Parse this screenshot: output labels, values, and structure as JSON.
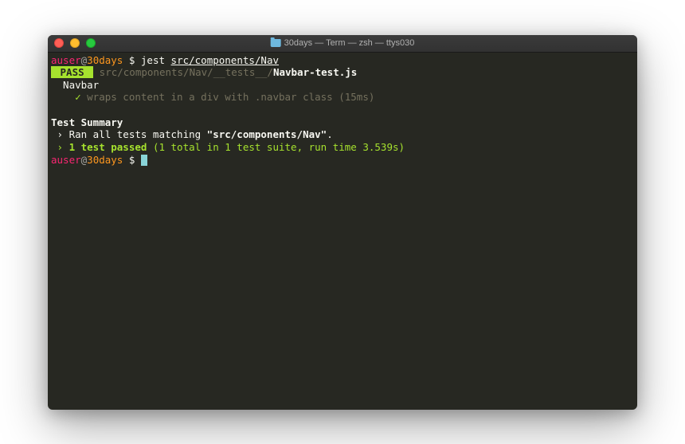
{
  "window": {
    "title": "30days — Term — zsh — ttys030"
  },
  "prompt": {
    "user": "auser",
    "at": "@",
    "host": "30days",
    "symbol": " $ ",
    "command": "jest ",
    "arg": "src/components/Nav"
  },
  "output": {
    "pass_label": " PASS ",
    "pass_path_dim": " src/components/Nav/__tests__/",
    "pass_file": "Navbar-test.js",
    "suite_name": "  Navbar",
    "check_mark": "    ✓ ",
    "test_desc": "wraps content in a div with .navbar class (15ms)",
    "summary_header": "Test Summary",
    "ran_prefix": " › Ran all tests matching ",
    "ran_match": "\"src/components/Nav\"",
    "ran_suffix": ".",
    "passed_prefix": " › ",
    "passed_bold": "1 test passed",
    "passed_rest": " (1 total in 1 test suite, run time 3.539s)"
  },
  "prompt2": {
    "user": "auser",
    "at": "@",
    "host": "30days",
    "symbol": " $ "
  }
}
